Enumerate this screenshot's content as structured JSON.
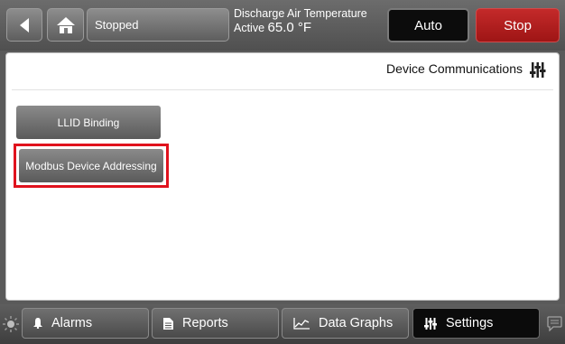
{
  "header": {
    "status": "Stopped",
    "setpoint_label": "Discharge Air Temperature",
    "setpoint_mode": "Active",
    "setpoint_value": "65.0 °F",
    "auto_label": "Auto",
    "stop_label": "Stop"
  },
  "page": {
    "title": "Device Communications",
    "buttons": [
      {
        "label": "LLID Binding"
      },
      {
        "label": "Modbus Device Addressing"
      }
    ]
  },
  "nav": {
    "tabs": [
      {
        "label": "Alarms",
        "icon": "bell-icon"
      },
      {
        "label": "Reports",
        "icon": "document-icon"
      },
      {
        "label": "Data Graphs",
        "icon": "chart-icon"
      },
      {
        "label": "Settings",
        "icon": "sliders-icon",
        "active": true
      }
    ]
  },
  "colors": {
    "stop": "#b01c1c",
    "highlight": "#e0121d",
    "active_tab": "#0b0b0b"
  }
}
